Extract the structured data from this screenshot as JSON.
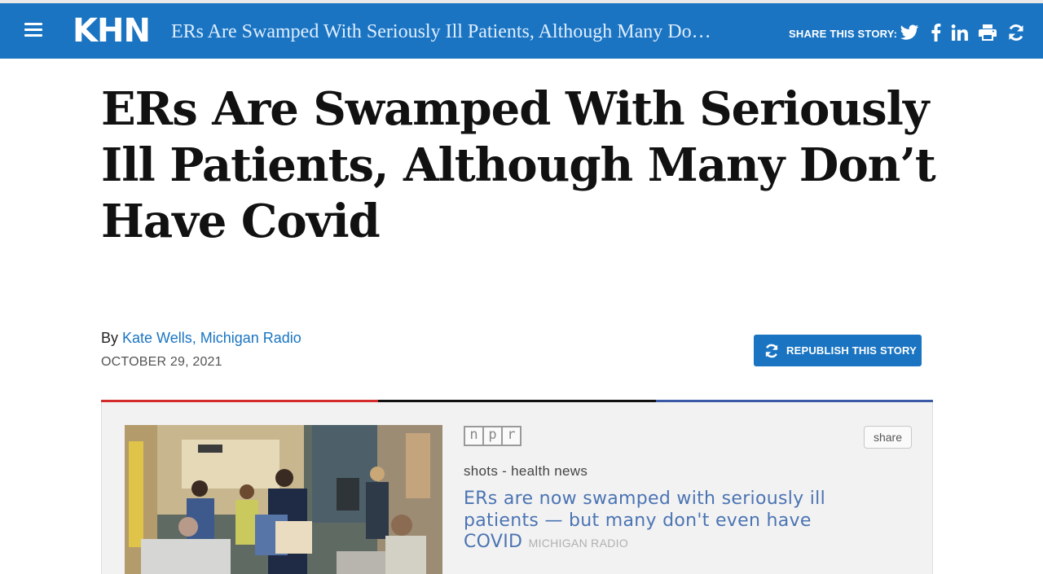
{
  "header": {
    "logo": "KHN",
    "title": "ERs Are Swamped With Seriously Ill Patients, Although Many Do…",
    "share_label": "SHARE THIS STORY:",
    "share_icons": [
      "twitter-icon",
      "facebook-icon",
      "linkedin-icon",
      "print-icon",
      "republish-icon"
    ]
  },
  "article": {
    "headline": "ERs Are Swamped With Seriously Ill Patients, Although Many Don’t Have Covid",
    "by_prefix": "By",
    "author": "Kate Wells, Michigan Radio",
    "date": "OCTOBER 29, 2021",
    "republish_label": "REPUBLISH THIS STORY"
  },
  "embed": {
    "npr_letters": [
      "n",
      "p",
      "r"
    ],
    "share_button": "share",
    "section": "shots - health news",
    "story_title": "ERs are now swamped with seriously ill patients — but many don't even have COVID",
    "source": "MICHIGAN RADIO"
  },
  "colors": {
    "brand_blue": "#1a74c2",
    "divider_red": "#d32b2b",
    "divider_black": "#111111",
    "divider_blue": "#3a5aa8",
    "link_blue": "#4b74b3"
  }
}
